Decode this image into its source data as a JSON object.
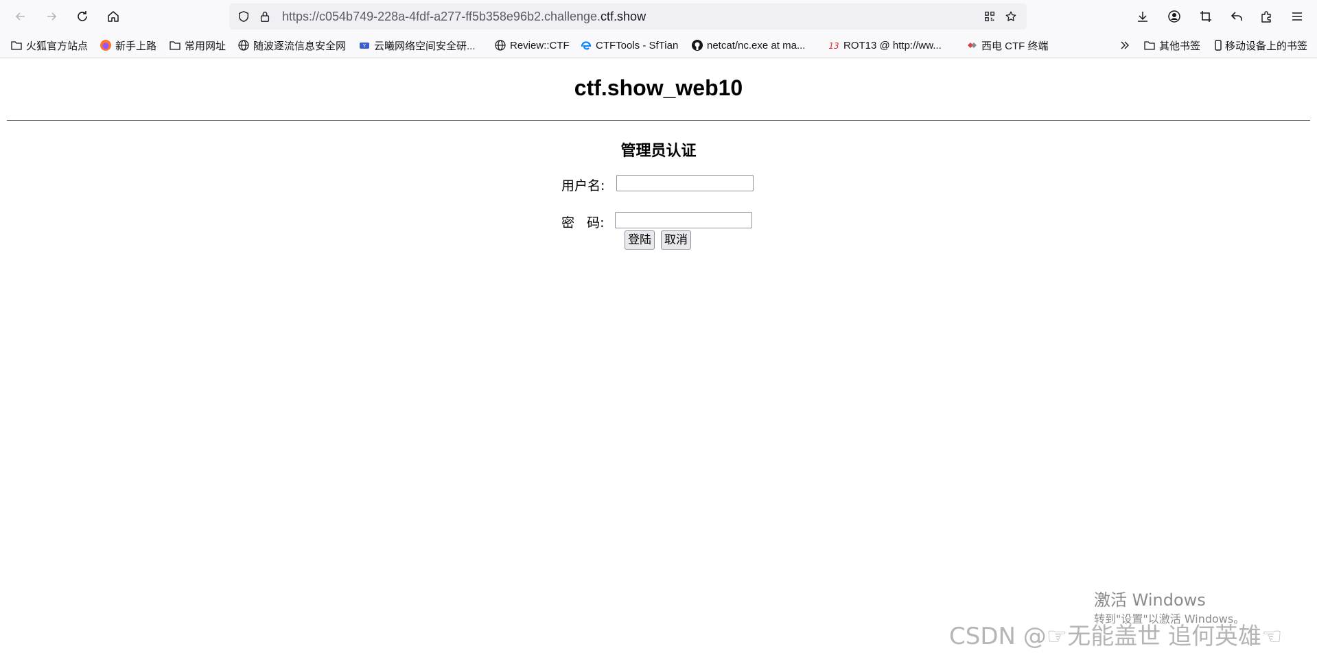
{
  "toolbar": {
    "back_icon": "arrow-left-icon",
    "forward_icon": "arrow-right-icon",
    "reload_icon": "reload-icon",
    "home_icon": "home-icon",
    "url_prefix": "https://c054b749-228a-4fdf-a277-ff5b358e96b2.challenge.",
    "url_domain": "ctf.show",
    "right_icons": [
      "download-icon",
      "account-icon",
      "crop-icon",
      "undo-icon",
      "extensions-icon",
      "menu-icon"
    ]
  },
  "bookmarks": {
    "items": [
      {
        "label": "火狐官方站点",
        "icon": "folder-icon"
      },
      {
        "label": "新手上路",
        "icon": "firefox-icon"
      },
      {
        "label": "常用网址",
        "icon": "folder-icon"
      },
      {
        "label": "随波逐流信息安全网",
        "icon": "globe-icon"
      },
      {
        "label": "云曦网络空间安全研...",
        "icon": "site-icon"
      },
      {
        "label": "Review::CTF",
        "icon": "globe-icon"
      },
      {
        "label": "CTFTools - SfTian",
        "icon": "edge-icon"
      },
      {
        "label": "netcat/nc.exe at ma...",
        "icon": "github-icon"
      },
      {
        "label": "ROT13 @ http://ww...",
        "icon": "rot13-icon"
      },
      {
        "label": "西电 CTF 终端",
        "icon": "site-icon"
      }
    ],
    "overflow_icon": "chevrons-right-icon",
    "other_bookmarks": "其他书签",
    "mobile_bookmarks": "移动设备上的书签"
  },
  "page": {
    "title": "ctf.show_web10",
    "heading": "管理员认证",
    "username_label": "用户名:",
    "username_value": "",
    "password_label": "密   码:",
    "password_value": "",
    "login_button": "登陆",
    "cancel_button": "取消"
  },
  "watermark": {
    "windows_line1": "激活 Windows",
    "windows_line2": "转到\"设置\"以激活 Windows。",
    "csdn": "CSDN @☞无能盖世 追何英雄☜"
  }
}
